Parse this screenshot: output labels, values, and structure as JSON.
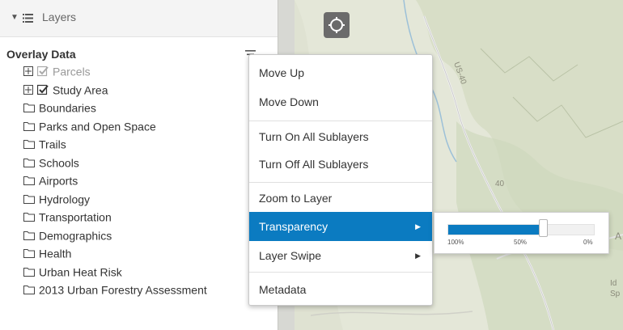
{
  "panel": {
    "header_title": "Layers",
    "section_title": "Overlay Data",
    "layers": [
      {
        "label": "Parcels",
        "expander": true,
        "check": "checked-disabled"
      },
      {
        "label": "Study Area",
        "expander": true,
        "check": "checked"
      },
      {
        "label": "Boundaries",
        "expander": false,
        "check": "folder"
      },
      {
        "label": "Parks and Open Space",
        "expander": false,
        "check": "folder"
      },
      {
        "label": "Trails",
        "expander": false,
        "check": "folder"
      },
      {
        "label": "Schools",
        "expander": false,
        "check": "folder"
      },
      {
        "label": "Airports",
        "expander": false,
        "check": "folder"
      },
      {
        "label": "Hydrology",
        "expander": false,
        "check": "folder"
      },
      {
        "label": "Transportation",
        "expander": false,
        "check": "folder"
      },
      {
        "label": "Demographics",
        "expander": false,
        "check": "folder"
      },
      {
        "label": "Health",
        "expander": false,
        "check": "folder"
      },
      {
        "label": "Urban Heat Risk",
        "expander": false,
        "check": "folder"
      },
      {
        "label": "2013 Urban Forestry Assessment",
        "expander": false,
        "check": "folder"
      }
    ]
  },
  "menu": {
    "move_up": "Move Up",
    "move_down": "Move Down",
    "turn_on": "Turn On All Sublayers",
    "turn_off": "Turn Off All Sublayers",
    "zoom": "Zoom to Layer",
    "transparency": "Transparency",
    "layer_swipe": "Layer Swipe",
    "metadata": "Metadata",
    "submenu_arrow": "▶"
  },
  "transparency": {
    "value_fraction": 0.65,
    "ticks": [
      "100%",
      "50%",
      "0%"
    ],
    "accent": "#0b7bc1"
  },
  "map": {
    "labels": [
      "US-40",
      "40",
      "A",
      "Id",
      "Sp"
    ]
  }
}
